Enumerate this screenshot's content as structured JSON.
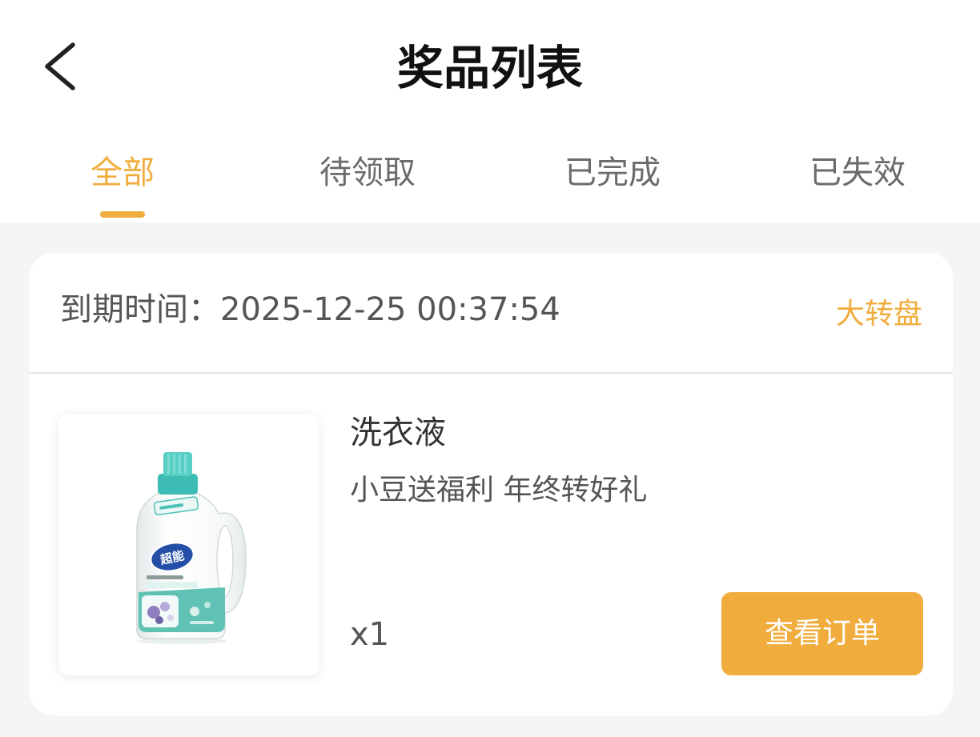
{
  "header": {
    "title": "奖品列表",
    "back_icon": "chevron-left-icon"
  },
  "tabs": [
    {
      "label": "全部",
      "active": true
    },
    {
      "label": "待领取",
      "active": false
    },
    {
      "label": "已完成",
      "active": false
    },
    {
      "label": "已失效",
      "active": false
    }
  ],
  "prize": {
    "expiry_label": "到期时间：",
    "expiry_time": "2025-12-25 00:37:54",
    "source": "大转盘",
    "name": "洗衣液",
    "description": "小豆送福利 年终转好礼",
    "quantity": "x1",
    "action_label": "查看订单",
    "image": {
      "icon": "laundry-detergent-bottle",
      "logo_text": "超能"
    }
  },
  "colors": {
    "accent": "#f0ad3e",
    "page_background": "#f5f5f5",
    "card_background": "#ffffff",
    "text_primary": "#333333",
    "text_secondary": "#555555",
    "tab_inactive": "#6b6b6b"
  }
}
